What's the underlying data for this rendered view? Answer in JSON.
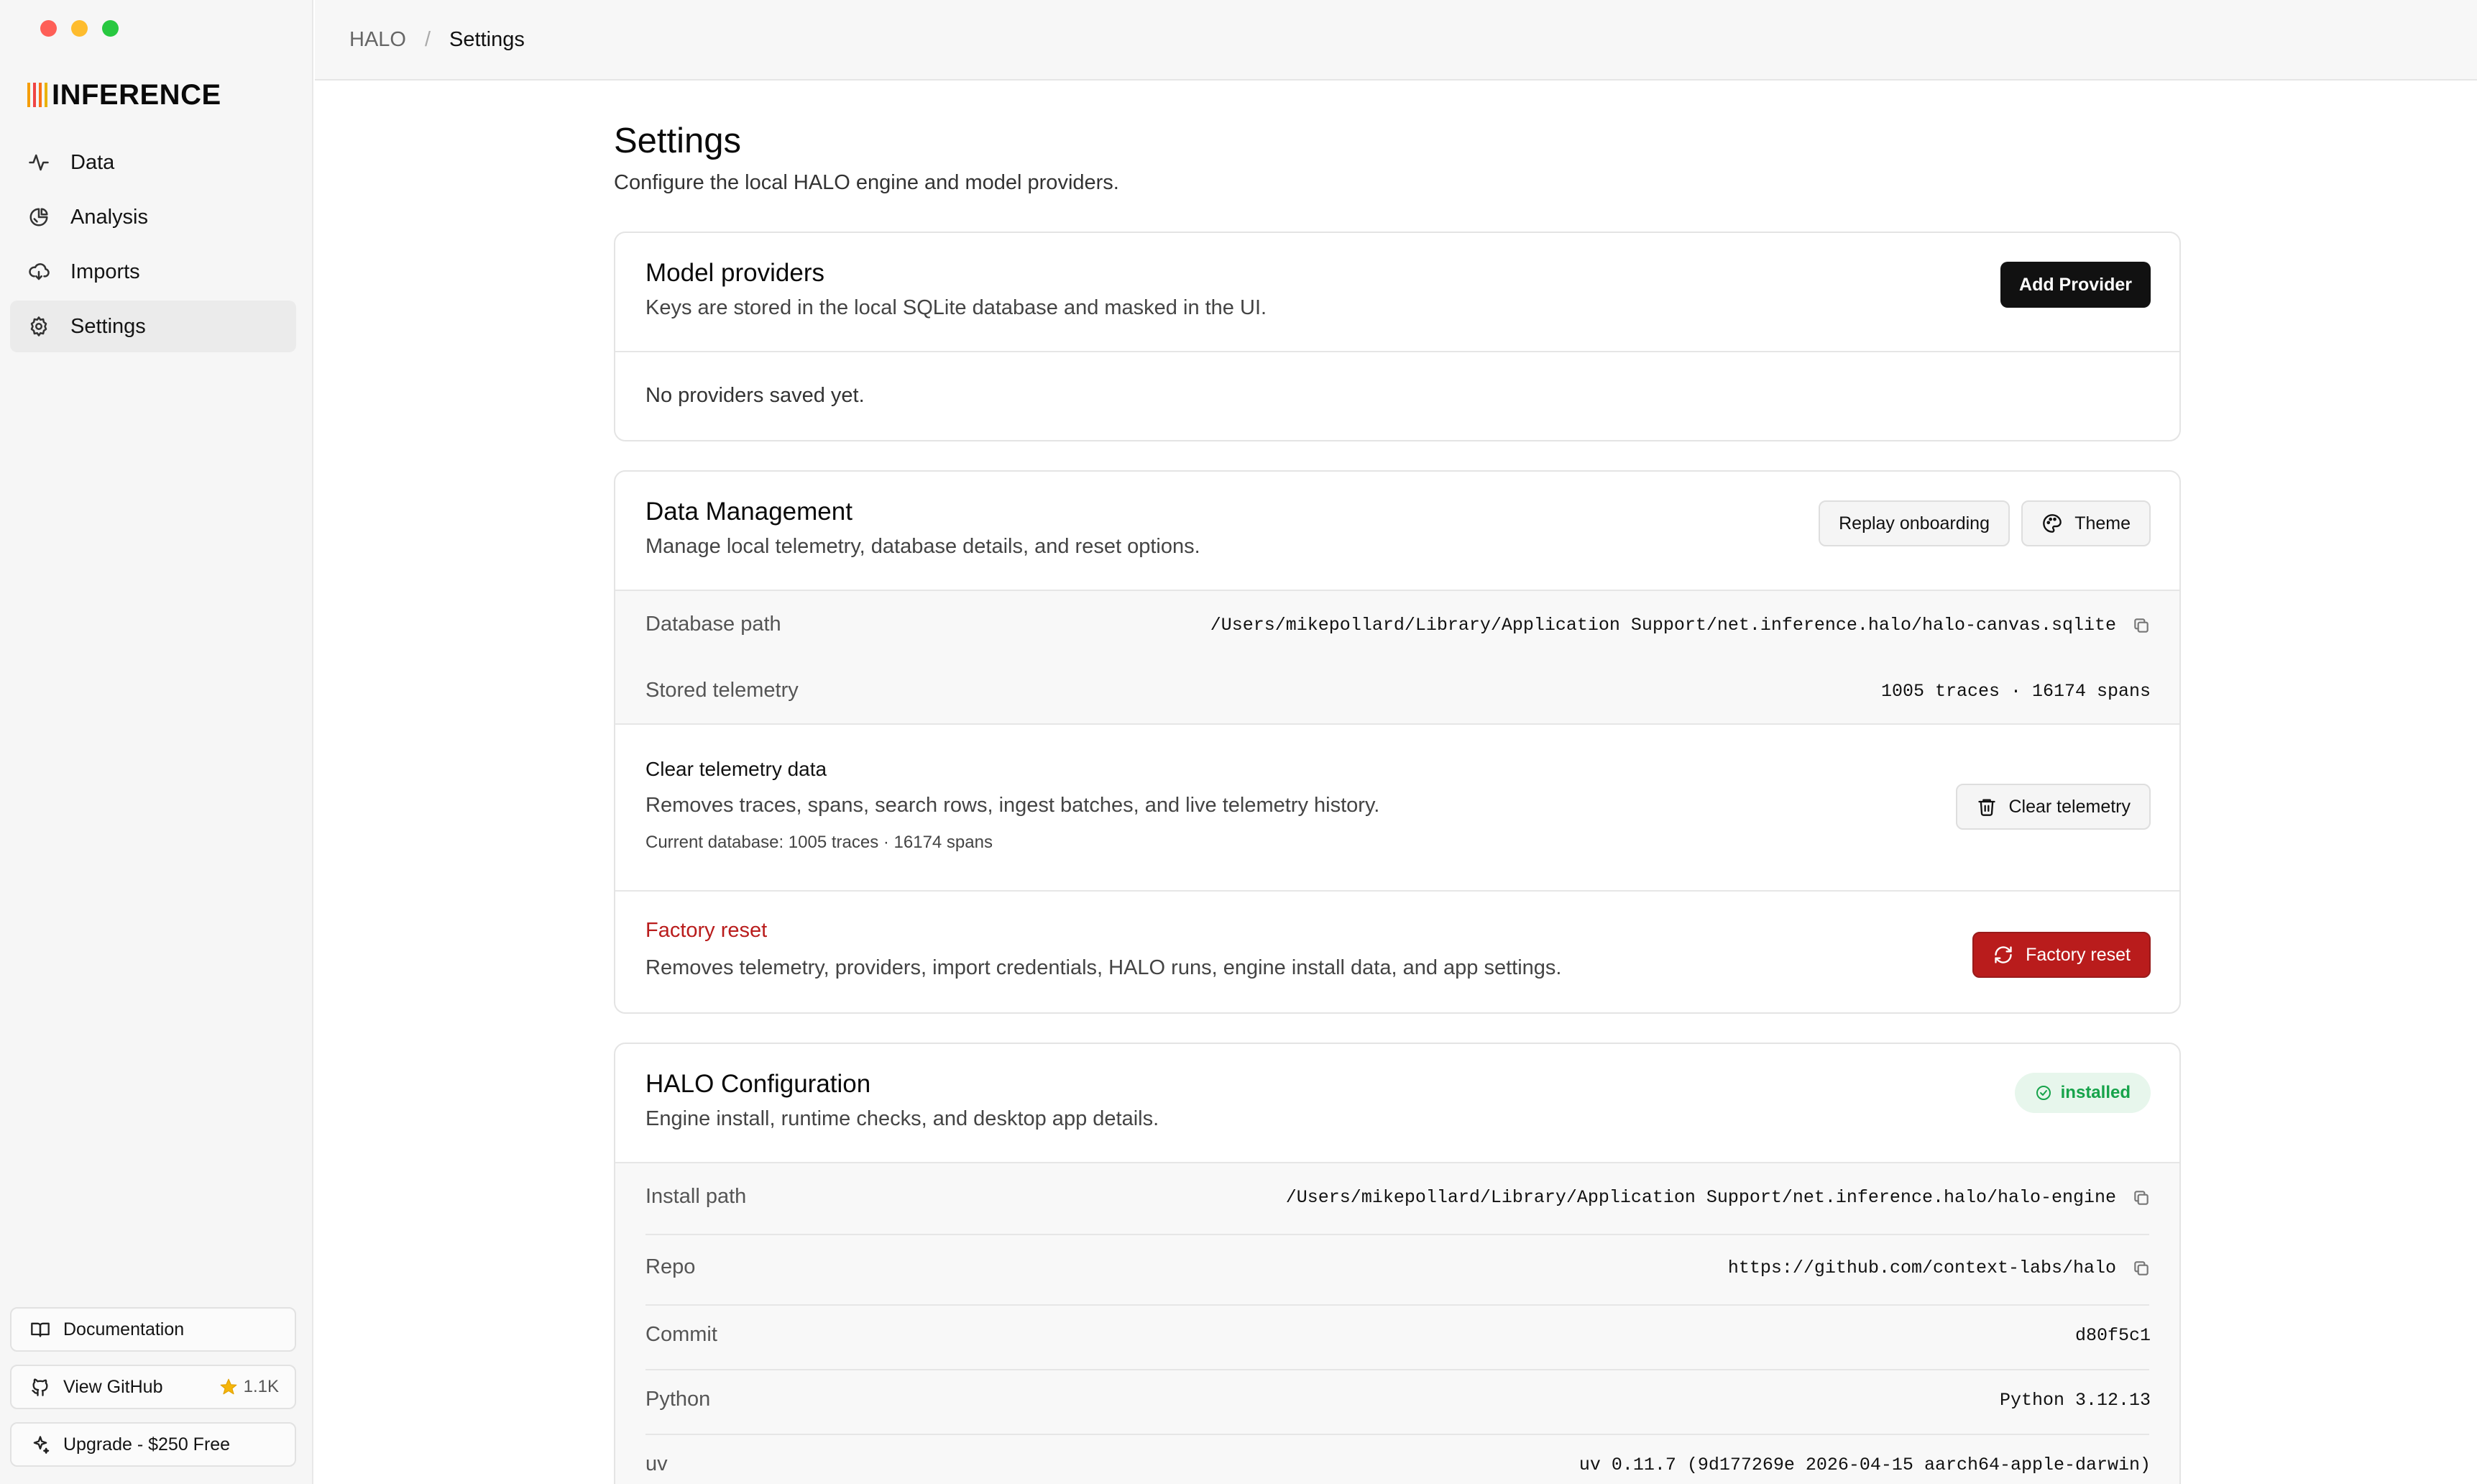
{
  "sidebar": {
    "brand": "INFERENCE",
    "brand_bar_colors": [
      "#f59e0b",
      "#ef4444",
      "#f97316",
      "#eab308"
    ],
    "nav": [
      {
        "label": "Data",
        "icon": "activity-icon"
      },
      {
        "label": "Analysis",
        "icon": "analysis-icon"
      },
      {
        "label": "Imports",
        "icon": "cloud-download-icon"
      },
      {
        "label": "Settings",
        "icon": "gear-icon",
        "active": true
      }
    ],
    "documentation_label": "Documentation",
    "github_label": "View GitHub",
    "github_stars": "1.1K",
    "upgrade_label": "Upgrade - $250 Free"
  },
  "breadcrumb": {
    "root": "HALO",
    "separator": "/",
    "current": "Settings"
  },
  "page": {
    "title": "Settings",
    "subtitle": "Configure the local HALO engine and model providers."
  },
  "providers": {
    "title": "Model providers",
    "desc": "Keys are stored in the local SQLite database and masked in the UI.",
    "add_label": "Add Provider",
    "empty": "No providers saved yet."
  },
  "data_mgmt": {
    "title": "Data Management",
    "desc": "Manage local telemetry, database details, and reset options.",
    "replay_label": "Replay onboarding",
    "theme_label": "Theme",
    "db_path_label": "Database path",
    "db_path_value": "/Users/mikepollard/Library/Application Support/net.inference.halo/halo-canvas.sqlite",
    "stored_label": "Stored telemetry",
    "stored_value": "1005 traces · 16174 spans",
    "clear_title": "Clear telemetry data",
    "clear_desc": "Removes traces, spans, search rows, ingest batches, and live telemetry history.",
    "clear_current": "Current database: 1005 traces · 16174 spans",
    "clear_button": "Clear telemetry",
    "factory_title": "Factory reset",
    "factory_desc": "Removes telemetry, providers, import credentials, HALO runs, engine install data, and app settings.",
    "factory_button": "Factory reset"
  },
  "halo_config": {
    "title": "HALO Configuration",
    "desc": "Engine install, runtime checks, and desktop app details.",
    "status": "installed",
    "rows": [
      {
        "label": "Install path",
        "value": "/Users/mikepollard/Library/Application Support/net.inference.halo/halo-engine",
        "copy": true
      },
      {
        "label": "Repo",
        "value": "https://github.com/context-labs/halo",
        "copy": true
      },
      {
        "label": "Commit",
        "value": "d80f5c1",
        "copy": false
      },
      {
        "label": "Python",
        "value": "Python 3.12.13",
        "copy": false
      },
      {
        "label": "uv",
        "value": "uv 0.11.7 (9d177269e 2026-04-15 aarch64-apple-darwin)",
        "copy": false
      }
    ]
  },
  "colors": {
    "danger": "#b91c1c",
    "success": "#16a34a"
  }
}
